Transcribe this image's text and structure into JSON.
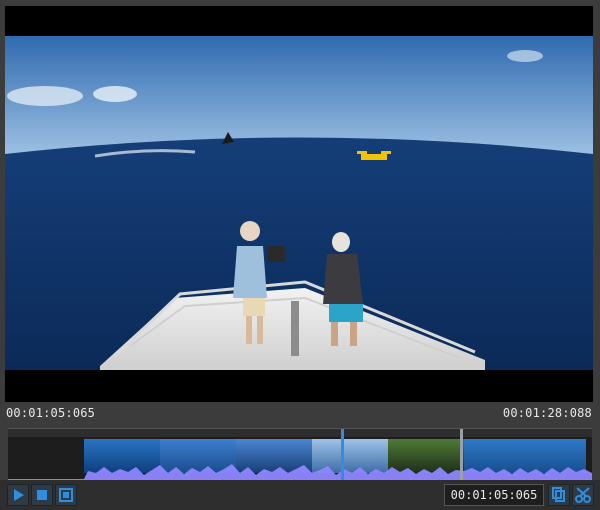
{
  "timecodes": {
    "start": "00:01:05:065",
    "end": "00:01:28:088",
    "current": "00:01:05:065"
  },
  "icons": {
    "play": "play-icon",
    "stop": "stop-icon",
    "fullscreen": "fullscreen-icon",
    "copy": "copy-icon",
    "cut": "scissors-icon"
  },
  "colors": {
    "accent": "#2f8ee0",
    "waveform": "#8f86ff"
  }
}
